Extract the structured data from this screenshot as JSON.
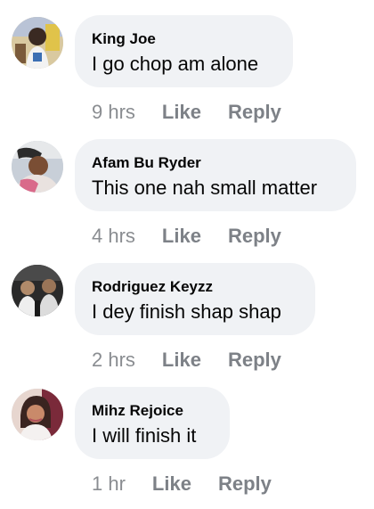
{
  "comments": [
    {
      "author": "King Joe",
      "text": "I go chop am alone",
      "time": "9 hrs",
      "like_label": "Like",
      "reply_label": "Reply"
    },
    {
      "author": "Afam Bu Ryder",
      "text": "This one nah small matter",
      "time": "4 hrs",
      "like_label": "Like",
      "reply_label": "Reply"
    },
    {
      "author": "Rodriguez Keyzz",
      "text": "I dey finish shap shap",
      "time": "2 hrs",
      "like_label": "Like",
      "reply_label": "Reply"
    },
    {
      "author": "Mihz Rejoice",
      "text": "I will finish it",
      "time": "1 hr",
      "like_label": "Like",
      "reply_label": "Reply"
    }
  ],
  "colors": {
    "bubble": "#f0f2f5",
    "text": "#050505",
    "meta": "#8a8d91",
    "action": "#7d8187"
  }
}
